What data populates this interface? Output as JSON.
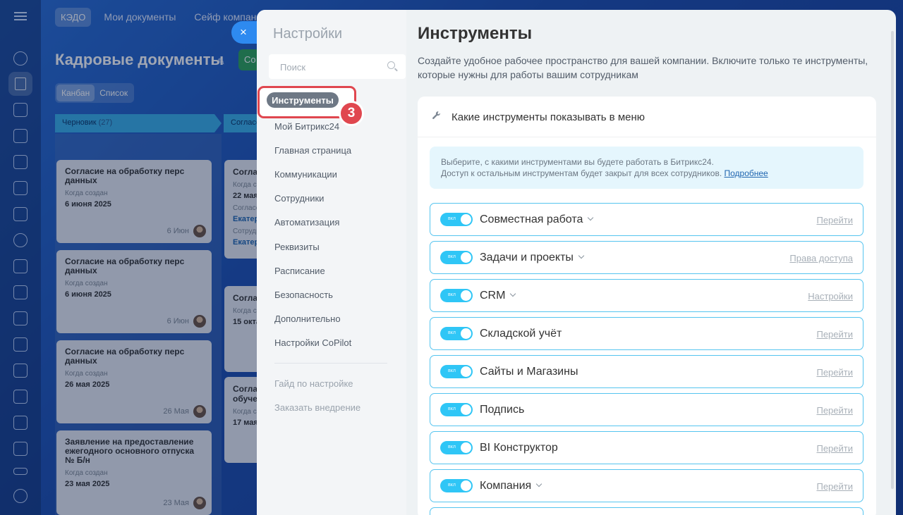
{
  "background": {
    "top_tabs": [
      "КЭДО",
      "Мои документы",
      "Сейф компании"
    ],
    "page_title": "Кадровые документы",
    "create_button": "Со",
    "view_switch": [
      "Канбан",
      "Список"
    ],
    "columns": [
      {
        "name": "Черновик",
        "count": "(27)"
      },
      {
        "name": "Согласо",
        "count": ""
      }
    ],
    "cards": [
      {
        "title": "Согласие на обработку перс данных",
        "created_label": "Когда создан",
        "date": "6 июня 2025",
        "foot": "6 Июн"
      },
      {
        "title": "Согласие на обработку перс данных",
        "created_label": "Когда создан",
        "date": "6 июня 2025",
        "foot": "6 Июн"
      },
      {
        "title": "Согласие на обработку перс данных",
        "created_label": "Когда создан",
        "date": "26 мая 2025",
        "foot": "26 Мая"
      },
      {
        "title": "Заявление на предоставление ежегодного основного отпуска № Б/н",
        "created_label": "Когда создан",
        "date": "23 мая 2025",
        "foot": "23 Мая"
      }
    ],
    "cards2": [
      {
        "title": "Соглас",
        "l1": "Когда с",
        "d1": "22 мая",
        "l2": "Согласо",
        "v2": "Екатер",
        "l3": "Сотрудн",
        "v3": "Екатер"
      },
      {
        "title": "Соглас",
        "l1": "Когда с",
        "d1": "15 окта"
      },
      {
        "title": "Соглас обучен",
        "l1": "Когда с",
        "d1": "17 мая"
      }
    ]
  },
  "close_label": "×",
  "settings": {
    "nav_title": "Настройки",
    "search_placeholder": "Поиск",
    "active_item": "Инструменты",
    "step_number": "3",
    "items": [
      "Мой Битрикс24",
      "Главная страница",
      "Коммуникации",
      "Сотрудники",
      "Автоматизация",
      "Реквизиты",
      "Расписание",
      "Безопасность",
      "Дополнительно",
      "Настройки CoPilot"
    ],
    "secondary_items": [
      "Гайд по настройке",
      "Заказать внедрение"
    ]
  },
  "content": {
    "title": "Инструменты",
    "description": "Создайте удобное рабочее пространство для вашей компании. Включите только те инструменты, которые нужны для работы вашим сотрудникам",
    "section_title": "Какие инструменты показывать в меню",
    "info_line1": "Выберите, с какими инструментами вы будете работать в Битрикс24.",
    "info_line2": "Доступ к остальным инструментам будет закрыт для всех сотрудников.",
    "info_link": "Подробнее",
    "toggle_on_label": "вкл",
    "tools": [
      {
        "name": "Совместная работа",
        "dropdown": true,
        "link": "Перейти"
      },
      {
        "name": "Задачи и проекты",
        "dropdown": true,
        "link": "Права доступа"
      },
      {
        "name": "CRM",
        "dropdown": true,
        "link": "Настройки"
      },
      {
        "name": "Складской учёт",
        "dropdown": false,
        "link": "Перейти"
      },
      {
        "name": "Сайты и Магазины",
        "dropdown": false,
        "link": "Перейти"
      },
      {
        "name": "Подпись",
        "dropdown": false,
        "link": "Перейти"
      },
      {
        "name": "BI Конструктор",
        "dropdown": false,
        "link": "Перейти"
      },
      {
        "name": "Компания",
        "dropdown": true,
        "link": "Перейти"
      }
    ]
  },
  "colors": {
    "accent": "#2fc6f6",
    "highlight_red": "#e0474f",
    "row_border": "#55c4ef"
  }
}
